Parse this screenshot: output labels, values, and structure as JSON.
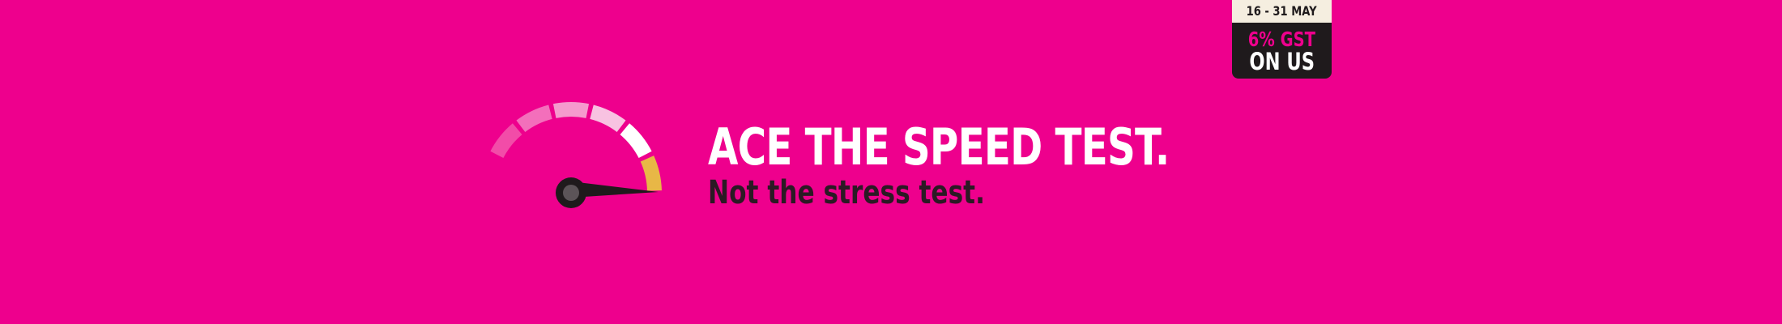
{
  "banner": {
    "background_color": "#ee008d",
    "headline": "ACE THE SPEED TEST.",
    "subheadline": "Not the stress test.",
    "icon": "speedometer-icon"
  },
  "gauge": {
    "segment_colors": [
      "#ee008d",
      "#f24ca8",
      "#f36fbb",
      "#f59acd",
      "#f8c2e1",
      "#ffffff",
      "#e8b746"
    ],
    "needle_color": "#1f1a1c",
    "hub_inner_color": "#5c5458",
    "highlight_color": "#e8b746"
  },
  "promo_badge": {
    "date_range": "16 - 31 MAY",
    "offer_line1": "6% GST",
    "offer_line2": "ON US",
    "accent_color": "#ee008d",
    "panel_color": "#1f1a1c",
    "date_bg_color": "#f5eee0"
  }
}
